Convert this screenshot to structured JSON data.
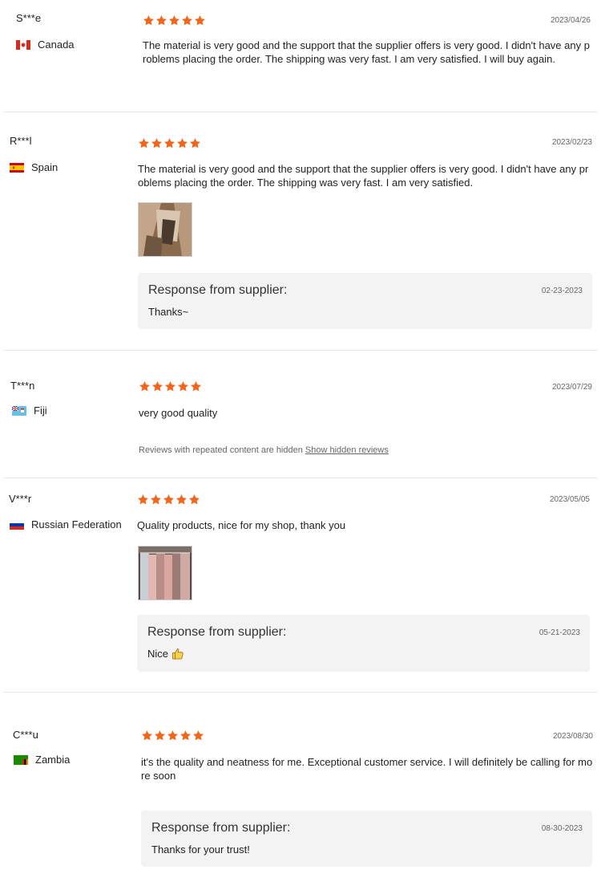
{
  "reviews": [
    {
      "user": "S***e",
      "country": "Canada",
      "flag": "canada-flag-icon",
      "rating": 5,
      "date": "2023/04/26",
      "text": "The material is very good and the support that the supplier offers is very good. I didn't have any problems placing the order. The shipping was very fast. I am very satisfied. I will buy again."
    },
    {
      "user": "R***l",
      "country": "Spain",
      "flag": "spain-flag-icon",
      "rating": 5,
      "date": "2023/02/23",
      "text": "The material is very good and the support that the supplier offers is very good. I didn't have any problems placing the order. The shipping was very fast. I am very satisfied.",
      "response": {
        "title": "Response from supplier:",
        "date": "02-23-2023",
        "text": "Thanks~"
      }
    },
    {
      "user": "T***n",
      "country": "Fiji",
      "flag": "fiji-flag-icon",
      "rating": 5,
      "date": "2023/07/29",
      "text": "very good quality",
      "hidden_note": "Reviews with repeated content are hidden",
      "hidden_link": "Show hidden reviews"
    },
    {
      "user": "V***r",
      "country": "Russian Federation",
      "flag": "russia-flag-icon",
      "rating": 5,
      "date": "2023/05/05",
      "text": "Quality products, nice for my shop, thank you",
      "response": {
        "title": "Response from supplier:",
        "date": "05-21-2023",
        "text": "Nice"
      }
    },
    {
      "user": "C***u",
      "country": "Zambia",
      "flag": "zambia-flag-icon",
      "rating": 5,
      "date": "2023/08/30",
      "text": "it's the quality and neatness for me. Exceptional customer service. I will definitely be calling for more soon",
      "response": {
        "title": "Response from supplier:",
        "date": "08-30-2023",
        "text": "Thanks for your trust!"
      }
    }
  ],
  "colors": {
    "star": "#f2661b",
    "response_bg": "#f3f3f3",
    "divider": "#eaeaea"
  }
}
